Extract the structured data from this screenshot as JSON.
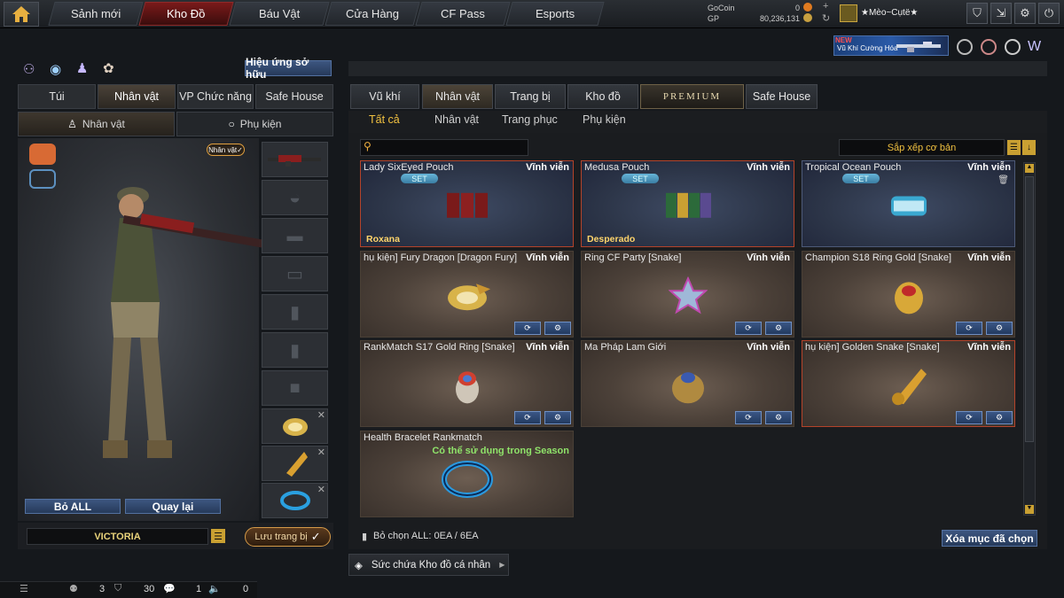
{
  "nav": {
    "tabs": [
      "Sảnh mới",
      "Kho Đồ",
      "Báu Vật",
      "Cửa Hàng",
      "CF Pass",
      "Esports"
    ],
    "active": 1
  },
  "currency": {
    "gocoin_label": "GoCoin",
    "gocoin_value": "0",
    "gp_label": "GP",
    "gp_value": "80,236,131"
  },
  "user": {
    "name": "★Mèo~Cụtë★"
  },
  "banner": {
    "badge": "NEW",
    "text": "Vũ Khí Cường Hóa"
  },
  "left": {
    "effects_button": "Hiệu ứng sở hữu",
    "tabs": [
      "Túi",
      "Nhân vật",
      "VP Chức năng",
      "Safe House"
    ],
    "subtabs": [
      "Nhân vật",
      "Phụ kiện"
    ],
    "char_badge": "Nhân vật",
    "remove_all": "Bỏ ALL",
    "back": "Quay lại",
    "character_name": "VICTORIA",
    "save_button": "Lưu trang bị"
  },
  "right": {
    "tabs": [
      "Vũ khí",
      "Nhân vật",
      "Trang bị",
      "Kho đồ",
      "PREMIUM",
      "Safe House"
    ],
    "categories": [
      "Tất cả",
      "Nhân vật",
      "Trang phục",
      "Phụ kiện"
    ],
    "sort_label": "Sắp xếp cơ bản",
    "search_placeholder": "",
    "items": [
      {
        "name": "Lady SixEyed Pouch",
        "duration": "Vĩnh viễn",
        "set": "SET",
        "sub": "Roxana",
        "style": "blue"
      },
      {
        "name": "Medusa Pouch",
        "duration": "Vĩnh viễn",
        "set": "SET",
        "sub": "Desperado",
        "style": "blue"
      },
      {
        "name": "Tropical Ocean Pouch",
        "duration": "Vĩnh viễn",
        "set": "SET",
        "sub": "",
        "style": "blue"
      },
      {
        "name": "hụ kiện] Fury Dragon [Dragon Fury]",
        "duration": "Vĩnh viễn"
      },
      {
        "name": "Ring CF Party [Snake]",
        "duration": "Vĩnh viễn"
      },
      {
        "name": "Champion S18 Ring Gold [Snake]",
        "duration": "Vĩnh viễn"
      },
      {
        "name": "RankMatch S17 Gold Ring [Snake]",
        "duration": "Vĩnh viễn"
      },
      {
        "name": "Ma Pháp Lam Giới",
        "duration": "Vĩnh viễn"
      },
      {
        "name": "hụ kiện] Golden Snake [Snake]",
        "duration": "Vĩnh viễn"
      },
      {
        "name": "Health Bracelet Rankmatch",
        "duration": "",
        "note": "Có thể sử dụng trong Season"
      }
    ],
    "selection_status": "Bỏ chọn ALL: 0EA / 6EA",
    "delete_selected": "Xóa mục đã chọn",
    "capacity_label": "Sức chứa Kho đồ cá nhân"
  },
  "status_bar": {
    "count1": "3",
    "count2": "30",
    "count3": "1",
    "count4": "0"
  }
}
